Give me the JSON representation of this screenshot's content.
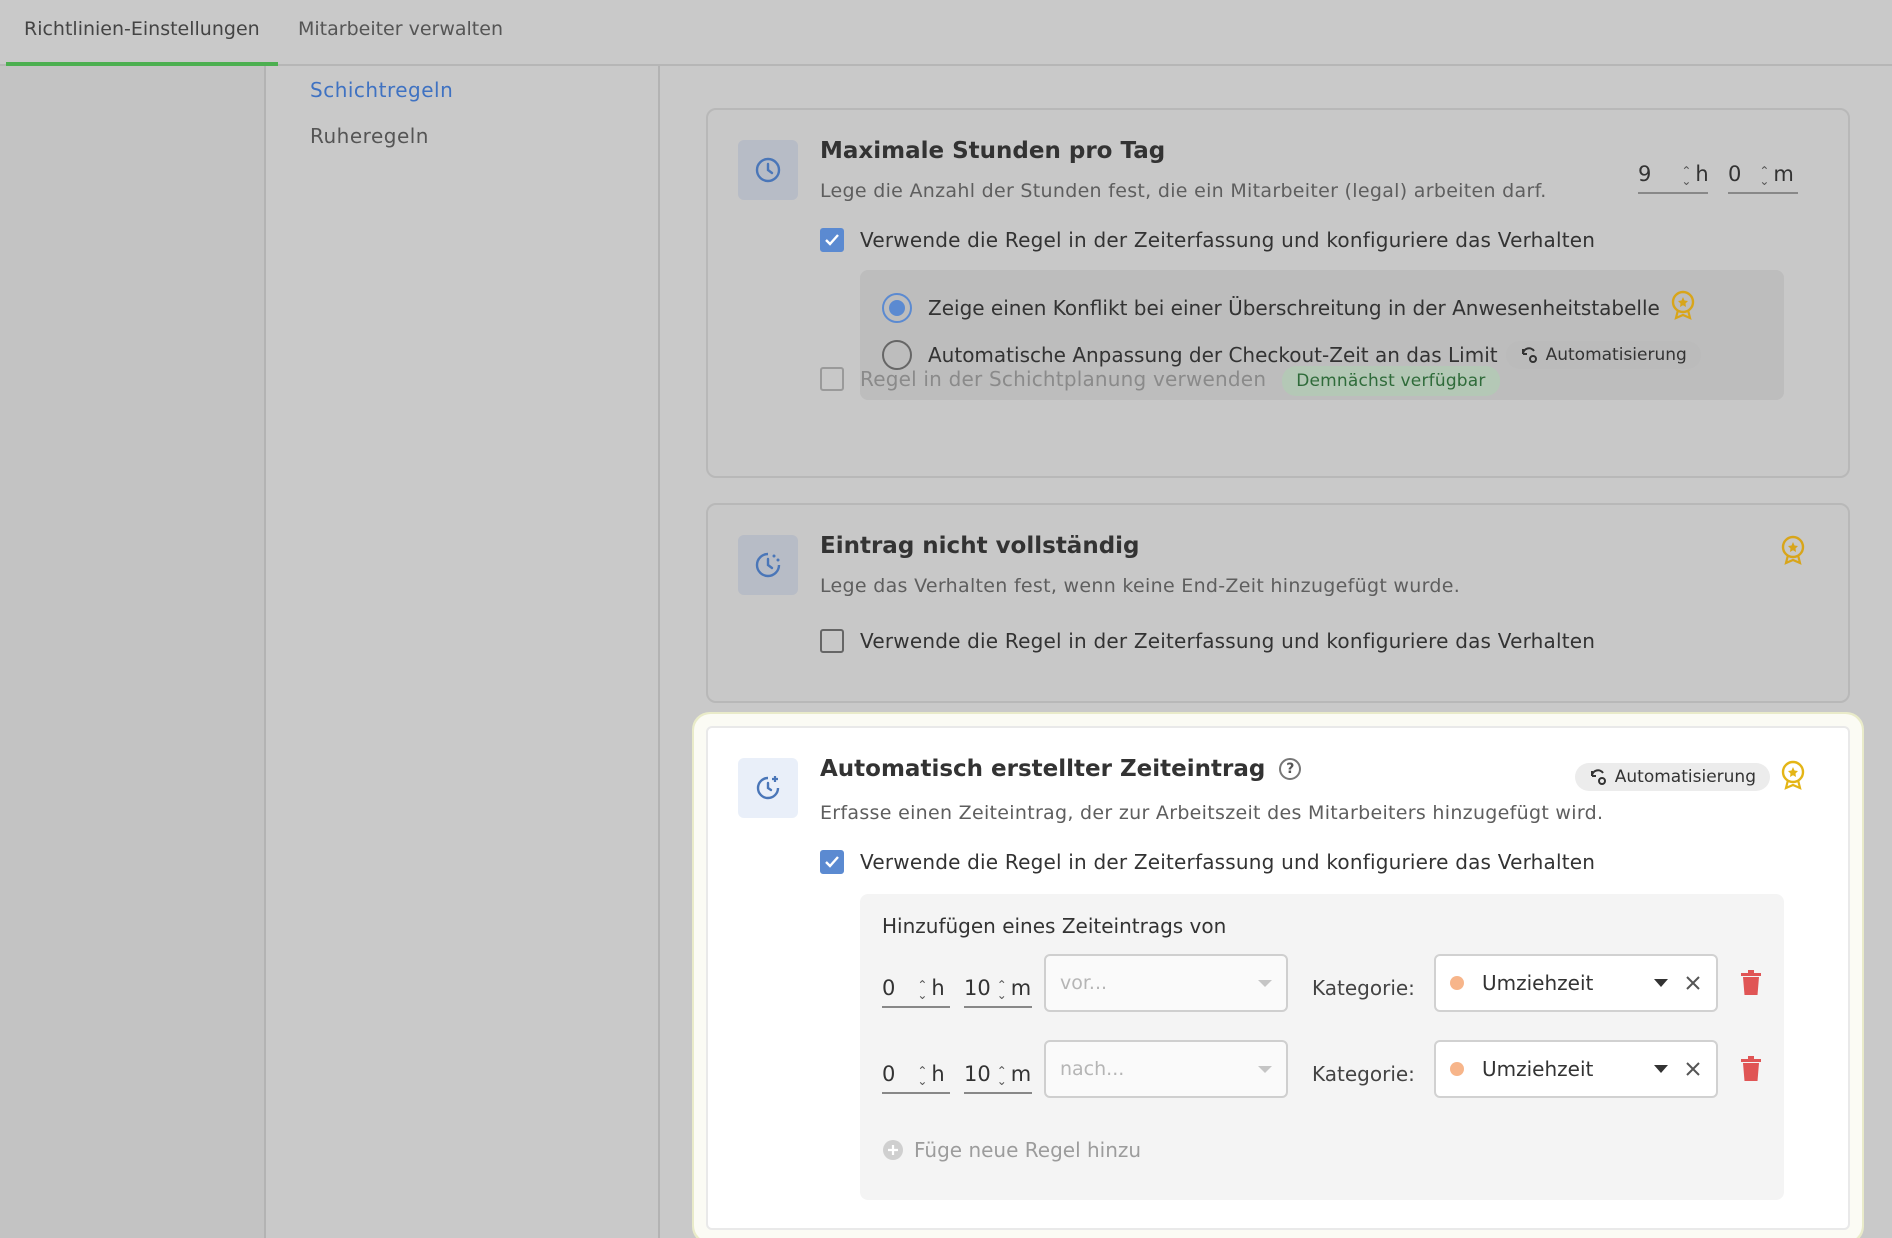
{
  "tabs": [
    {
      "label": "Richtlinien-Einstellungen",
      "active": true
    },
    {
      "label": "Mitarbeiter verwalten",
      "active": false
    }
  ],
  "subnav": [
    {
      "label": "Schichtregeln",
      "active": true
    },
    {
      "label": "Ruheregeln",
      "active": false
    }
  ],
  "colors": {
    "accent": "#5b8ad1",
    "tab_active": "#4caf50",
    "premium": "#d8a51a",
    "danger": "#e05555",
    "category_dot": "#f7b58a"
  },
  "card1": {
    "title": "Maximale Stunden pro Tag",
    "desc": "Lege die Anzahl der Stunden fest, die ein Mitarbeiter (legal) arbeiten darf.",
    "hours": "9",
    "hours_unit": "h",
    "minutes": "0",
    "minutes_unit": "m",
    "use_rule_label": "Verwende die Regel in der Zeiterfassung und konfiguriere das Verhalten",
    "use_rule_checked": true,
    "option1": "Zeige einen Konflikt bei einer Überschreitung in der Anwesenheitstabelle",
    "option2": "Automatische Anpassung der Checkout-Zeit an das Limit",
    "automation_label": "Automatisierung",
    "shift_rule_label": "Regel in der Schichtplanung verwenden",
    "coming_soon": "Demnächst verfügbar"
  },
  "card2": {
    "title": "Eintrag nicht vollständig",
    "desc": "Lege das Verhalten fest, wenn keine End-Zeit hinzugefügt wurde.",
    "use_rule_label": "Verwende die Regel in der Zeiterfassung und konfiguriere das Verhalten",
    "use_rule_checked": false
  },
  "card3": {
    "title": "Automatisch erstellter Zeiteintrag",
    "help": "?",
    "automation_label": "Automatisierung",
    "desc": "Erfasse einen Zeiteintrag, der zur Arbeitszeit des Mitarbeiters hinzugefügt wird.",
    "use_rule_label": "Verwende die Regel in der Zeiterfassung und konfiguriere das Verhalten",
    "use_rule_checked": true,
    "section_title": "Hinzufügen eines Zeiteintrags von",
    "rows": [
      {
        "hours": "0",
        "hours_unit": "h",
        "minutes": "10",
        "minutes_unit": "m",
        "position_placeholder": "vor...",
        "category_label": "Kategorie:",
        "category": "Umziehzeit"
      },
      {
        "hours": "0",
        "hours_unit": "h",
        "minutes": "10",
        "minutes_unit": "m",
        "position_placeholder": "nach...",
        "category_label": "Kategorie:",
        "category": "Umziehzeit"
      }
    ],
    "add_rule": "Füge neue Regel hinzu"
  }
}
